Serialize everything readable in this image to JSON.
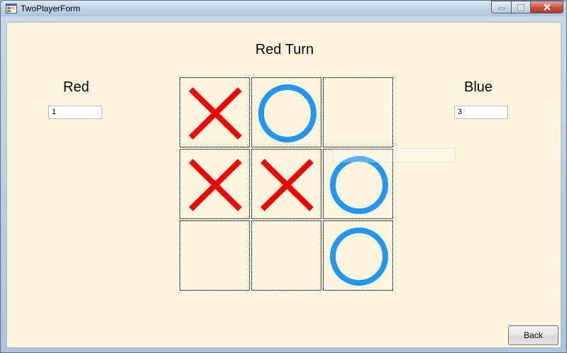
{
  "window": {
    "title": "TwoPlayerForm"
  },
  "turn_label": "Red Turn",
  "players": {
    "red": {
      "name": "Red",
      "score": "1"
    },
    "blue": {
      "name": "Blue",
      "score": "3"
    }
  },
  "board": [
    [
      "X",
      "O",
      ""
    ],
    [
      "X",
      "X",
      "O"
    ],
    [
      "",
      "",
      "O"
    ]
  ],
  "colors": {
    "x_mark": "#f20000",
    "o_mark": "#2196f3",
    "background": "#fdf6dc"
  },
  "buttons": {
    "back": "Back"
  },
  "caption_icons": [
    "minimize-icon",
    "maximize-icon",
    "close-icon"
  ]
}
